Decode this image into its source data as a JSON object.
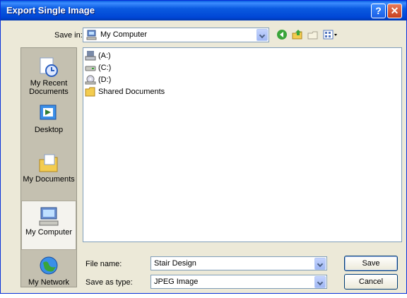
{
  "window": {
    "title": "Export Single Image",
    "help_glyph": "?",
    "close_glyph": "✕"
  },
  "save_in": {
    "label": "Save in:",
    "value": "My Computer"
  },
  "places": [
    {
      "label": "My Recent Documents",
      "icon": "recent-documents-icon"
    },
    {
      "label": "Desktop",
      "icon": "desktop-icon"
    },
    {
      "label": "My Documents",
      "icon": "my-documents-icon"
    },
    {
      "label": "My Computer",
      "icon": "my-computer-icon"
    },
    {
      "label": "My Network",
      "icon": "my-network-icon"
    }
  ],
  "files": [
    {
      "label": "(A:)",
      "icon": "floppy-drive-icon"
    },
    {
      "label": "(C:)",
      "icon": "hard-drive-icon"
    },
    {
      "label": "(D:)",
      "icon": "cd-drive-icon"
    },
    {
      "label": "Shared Documents",
      "icon": "folder-icon"
    }
  ],
  "file_name": {
    "label": "File name:",
    "value": "Stair Design"
  },
  "save_as_type": {
    "label": "Save as type:",
    "value": "JPEG Image"
  },
  "buttons": {
    "save": "Save",
    "cancel": "Cancel"
  }
}
